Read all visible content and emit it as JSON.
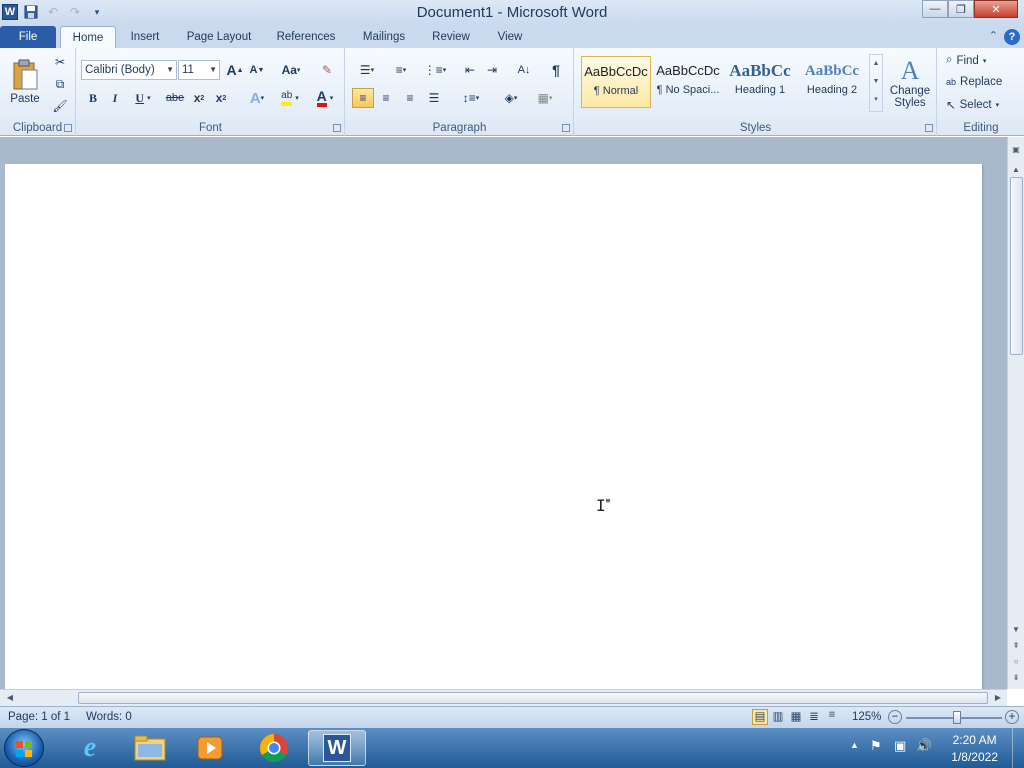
{
  "window": {
    "title": "Document1  -  Microsoft Word"
  },
  "quick_access": {
    "logo": "W",
    "save_icon": "save-icon",
    "undo_icon": "undo-icon",
    "redo_icon": "redo-icon",
    "customize_icon": "chevron-down-icon"
  },
  "window_controls": {
    "minimize": "—",
    "restore": "❐",
    "close": "✕"
  },
  "tabs": [
    {
      "label": "File"
    },
    {
      "label": "Home"
    },
    {
      "label": "Insert"
    },
    {
      "label": "Page Layout"
    },
    {
      "label": "References"
    },
    {
      "label": "Mailings"
    },
    {
      "label": "Review"
    },
    {
      "label": "View"
    }
  ],
  "ribbon": {
    "clipboard": {
      "label": "Clipboard",
      "paste": "Paste"
    },
    "font": {
      "label": "Font",
      "font_name": "Calibri (Body)",
      "font_size": "11",
      "grow": "A",
      "shrink": "A",
      "case": "Aa",
      "bold": "B",
      "italic": "I",
      "underline": "U",
      "strike": "abe",
      "subscript": "x",
      "superscript": "x",
      "text_effects": "A",
      "highlight": "ab",
      "font_color": "A"
    },
    "paragraph": {
      "label": "Paragraph",
      "sort": "A↓",
      "show_marks": "¶"
    },
    "styles": {
      "label": "Styles",
      "items": [
        {
          "preview": "AaBbCcDc",
          "name": "¶ Normal"
        },
        {
          "preview": "AaBbCcDc",
          "name": "¶ No Spaci..."
        },
        {
          "preview": "AaBbCc",
          "name": "Heading 1"
        },
        {
          "preview": "AaBbCc",
          "name": "Heading 2"
        }
      ],
      "change_styles": "Change",
      "change_styles_2": "Styles"
    },
    "editing": {
      "label": "Editing",
      "find": "Find",
      "replace": "Replace",
      "select": "Select"
    }
  },
  "status": {
    "page": "Page: 1 of 1",
    "words": "Words: 0",
    "zoom": "125%"
  },
  "taskbar": {
    "time": "2:20 AM",
    "date": "1/8/2022"
  }
}
